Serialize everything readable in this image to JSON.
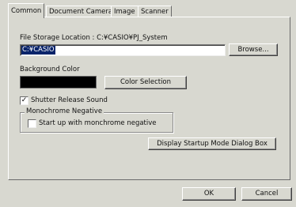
{
  "tabs": [
    {
      "label": "Common",
      "active": true
    },
    {
      "label": "Document Camera",
      "active": false
    },
    {
      "label": "Image",
      "active": false
    },
    {
      "label": "Scanner",
      "active": false
    }
  ],
  "file_storage": {
    "label": "File Storage Location : C:¥CASIO¥PJ_System",
    "value": "C:¥CASIO",
    "browse_label": "Browse..."
  },
  "background": {
    "label": "Background Color",
    "swatch_color": "#000000",
    "button_label": "Color Selection"
  },
  "shutter_sound": {
    "label": "Shutter Release Sound",
    "checked": true,
    "mark": "✓"
  },
  "monochrome": {
    "group_title": "Monochrome Negative",
    "checkbox_label": "Start up with monchrome negative",
    "checked": false
  },
  "startup_button_label": "Display Startup Mode Dialog Box",
  "footer": {
    "ok_label": "OK",
    "cancel_label": "Cancel"
  }
}
